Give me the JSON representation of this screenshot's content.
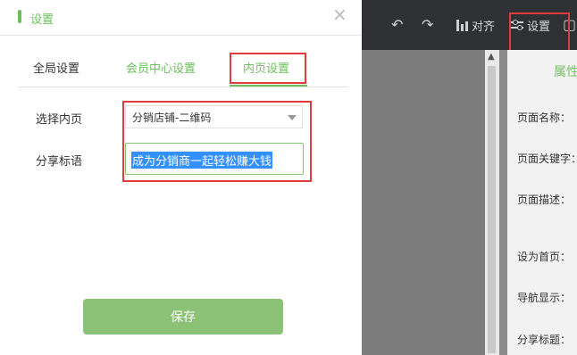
{
  "toolbar": {
    "undo_icon": "undo-icon",
    "redo_icon": "redo-icon",
    "align_label": "对齐",
    "settings_label": "设置",
    "colors": {
      "background": "#2f3033",
      "text": "#d8d8d8",
      "highlight": "#e23b3b"
    }
  },
  "dialog": {
    "title": "设置",
    "close_glyph": "×",
    "tabs": [
      {
        "label": "全局设置",
        "active": false
      },
      {
        "label": "会员中心设置",
        "active": false
      },
      {
        "label": "内页设置",
        "active": true
      }
    ],
    "fields": {
      "select_page_label": "选择内页",
      "select_page_value": "分销店铺-二维码",
      "share_title_label": "分享标语",
      "share_title_value": "成为分销商一起轻松赚大钱"
    },
    "save_label": "保存",
    "accent_color": "#6cbf5c"
  },
  "properties_panel": {
    "title": "属性",
    "labels": [
      "页面名称：",
      "页面关键字：",
      "页面描述：",
      "设为首页：",
      "导航显示：",
      "分享标题："
    ]
  }
}
